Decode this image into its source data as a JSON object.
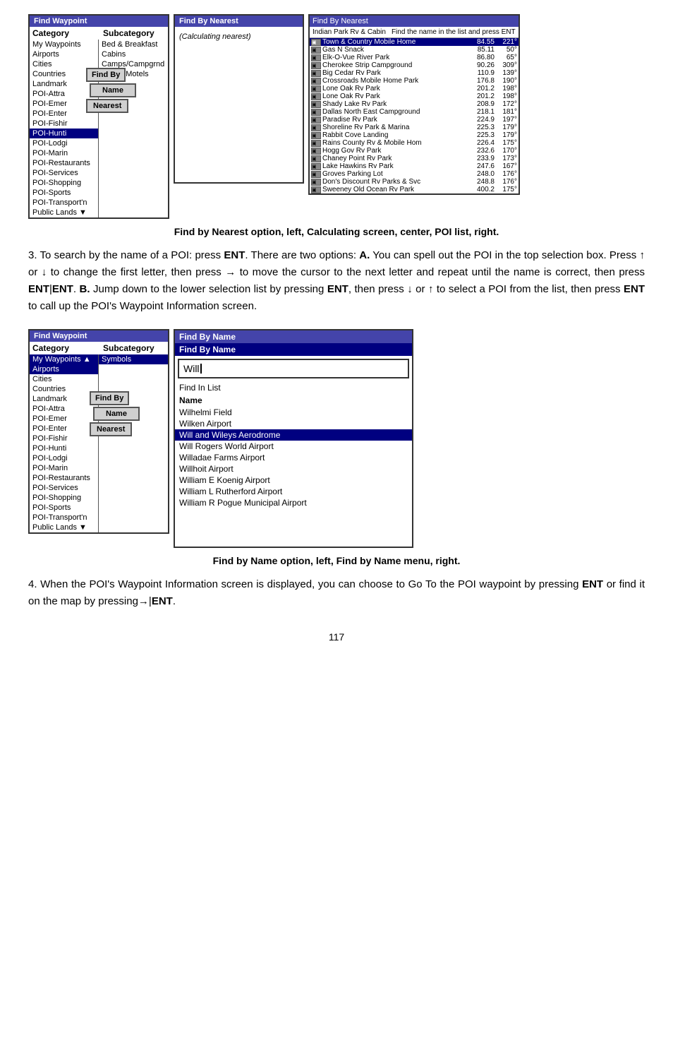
{
  "top_section": {
    "find_waypoint_panel": {
      "title": "Find Waypoint",
      "col1_header": "Category",
      "col2_header": "Subcategory",
      "categories": [
        {
          "label": "My Waypoints",
          "selected": false
        },
        {
          "label": "Airports",
          "selected": false
        },
        {
          "label": "Cities",
          "selected": false
        },
        {
          "label": "Countries",
          "selected": false
        },
        {
          "label": "Landmark",
          "selected": false
        },
        {
          "label": "POI-Attra",
          "selected": false
        },
        {
          "label": "POI-Emer",
          "selected": false
        },
        {
          "label": "POI-Enter",
          "selected": false
        },
        {
          "label": "POI-Fishir",
          "selected": false
        },
        {
          "label": "POI-Hunti",
          "selected": true
        },
        {
          "label": "POI-Lodgi",
          "selected": false
        },
        {
          "label": "POI-Marin",
          "selected": false
        },
        {
          "label": "POI-Restaurants",
          "selected": false
        },
        {
          "label": "POI-Services",
          "selected": false
        },
        {
          "label": "POI-Shopping",
          "selected": false
        },
        {
          "label": "POI-Sports",
          "selected": false
        },
        {
          "label": "POI-Transport'n",
          "selected": false
        },
        {
          "label": "Public Lands",
          "selected": false
        }
      ],
      "subcategories": [
        {
          "label": "Bed & Breakfast"
        },
        {
          "label": "Cabins"
        },
        {
          "label": "Camps/Campgrnd"
        },
        {
          "label": "Hotels/Motels"
        }
      ],
      "find_by_label": "Find By",
      "name_label": "Name",
      "nearest_label": "Nearest"
    },
    "find_by_nearest_panel": {
      "title": "Find By Nearest",
      "content": "(Calculating nearest)"
    },
    "find_by_nearest_results": {
      "title": "Find By Nearest",
      "prompt": "Find the name in the list",
      "prompt2": "and press ENT",
      "search_label": "Indian Park Rv & Cabin",
      "results": [
        {
          "icon": "rv",
          "name": "Town & Country Mobile Home",
          "dist": "84.55",
          "bearing": "221°",
          "selected": true
        },
        {
          "icon": "rv",
          "name": "Gas N Snack",
          "dist": "85.11",
          "bearing": "50°"
        },
        {
          "icon": "rv",
          "name": "Elk-O-Vue River Park",
          "dist": "86.80",
          "bearing": "65°"
        },
        {
          "icon": "rv",
          "name": "Cherokee Strip Campground",
          "dist": "90.26",
          "bearing": "309°"
        },
        {
          "icon": "rv",
          "name": "Big Cedar Rv Park",
          "dist": "110.9",
          "bearing": "139°"
        },
        {
          "icon": "rv",
          "name": "Crossroads Mobile Home Park",
          "dist": "176.8",
          "bearing": "190°"
        },
        {
          "icon": "rv",
          "name": "Lone Oak Rv Park",
          "dist": "201.2",
          "bearing": "198°"
        },
        {
          "icon": "rv",
          "name": "Lone Oak Rv Park",
          "dist": "201.2",
          "bearing": "198°"
        },
        {
          "icon": "rv",
          "name": "Shady Lake Rv Park",
          "dist": "208.9",
          "bearing": "172°"
        },
        {
          "icon": "rv",
          "name": "Dallas North East Campground",
          "dist": "218.1",
          "bearing": "181°"
        },
        {
          "icon": "rv",
          "name": "Paradise Rv Park",
          "dist": "224.9",
          "bearing": "197°"
        },
        {
          "icon": "rv",
          "name": "Shoreline Rv Park & Marina",
          "dist": "225.3",
          "bearing": "179°"
        },
        {
          "icon": "rv",
          "name": "Rabbit Cove Landing",
          "dist": "225.3",
          "bearing": "179°"
        },
        {
          "icon": "rv",
          "name": "Rains County Rv & Mobile Hom",
          "dist": "226.4",
          "bearing": "175°"
        },
        {
          "icon": "rv",
          "name": "Hogg Gov Rv Park",
          "dist": "232.6",
          "bearing": "170°"
        },
        {
          "icon": "rv",
          "name": "Chaney Point Rv Park",
          "dist": "233.9",
          "bearing": "173°"
        },
        {
          "icon": "rv",
          "name": "Lake Hawkins Rv Park",
          "dist": "247.6",
          "bearing": "167°"
        },
        {
          "icon": "rv",
          "name": "Groves Parking Lot",
          "dist": "248.0",
          "bearing": "176°"
        },
        {
          "icon": "rv",
          "name": "Don's Discount Rv Parks & Svc",
          "dist": "248.8",
          "bearing": "176°"
        },
        {
          "icon": "rv",
          "name": "Sweeney Old Ocean Rv Park",
          "dist": "400.2",
          "bearing": "175°"
        }
      ]
    }
  },
  "top_caption": "Find by Nearest option, left, Calculating screen, center, POI list, right.",
  "para1": {
    "text_before_a": "3. To search by the name of a POI: press ",
    "ent1": "ENT",
    "text_after_ent1": ". There are two options: ",
    "bold_a": "A.",
    "text_a": " You can spell out the POI in the top selection box. Press ",
    "arrow_up": "↑",
    "text_or": " or ",
    "arrow_down": "↓",
    "text_to": " to change the first letter, then press ",
    "arrow_right": "→",
    "text_move": " to move the cursor to the next letter and repeat until the name is correct, then press ",
    "ent2": "ENT",
    "pipe": "|",
    "ent3": "ENT",
    "text_b": ". ",
    "bold_b": "B.",
    "text_b2": " Jump down to the lower selection list by pressing ",
    "ent4": "ENT",
    "text_then": ", then press ",
    "arrow_down2": "↓",
    "text_or2": " or ",
    "arrow_up2": "↑",
    "text_select": " to select a POI from the list, then press ",
    "ent5": "ENT",
    "text_call": " to call up the POI's Waypoint Information screen."
  },
  "bottom_section": {
    "find_waypoint_panel2": {
      "title": "Find Waypoint",
      "col1_header": "Category",
      "col2_header": "Subcategory",
      "categories": [
        {
          "label": "My Waypoints",
          "selected": false
        },
        {
          "label": "Airports",
          "selected": true
        },
        {
          "label": "Cities",
          "selected": false
        },
        {
          "label": "Countries",
          "selected": false
        },
        {
          "label": "Landmark",
          "selected": false
        },
        {
          "label": "POI-Attra",
          "selected": false
        },
        {
          "label": "POI-Emer",
          "selected": false
        },
        {
          "label": "POI-Enter",
          "selected": false
        },
        {
          "label": "POI-Fishir",
          "selected": false
        },
        {
          "label": "POI-Hunti",
          "selected": false
        },
        {
          "label": "POI-Lodgi",
          "selected": false
        },
        {
          "label": "POI-Marin",
          "selected": false
        },
        {
          "label": "POI-Restaurants",
          "selected": false
        },
        {
          "label": "POI-Services",
          "selected": false
        },
        {
          "label": "POI-Shopping",
          "selected": false
        },
        {
          "label": "POI-Sports",
          "selected": false
        },
        {
          "label": "POI-Transport'n",
          "selected": false
        },
        {
          "label": "Public Lands",
          "selected": false
        }
      ],
      "subcategories": [
        {
          "label": "Symbols"
        }
      ],
      "find_by_label": "Find By",
      "name_label": "Name",
      "nearest_label": "Nearest"
    },
    "find_by_name_panel": {
      "title": "Find By Name",
      "subtitle": "Find By Name",
      "search_value": "Will",
      "find_in_list": "Find In List",
      "name_col": "Name",
      "items": [
        {
          "label": "Wilhelmi Field",
          "selected": false
        },
        {
          "label": "Wilken Airport",
          "selected": false
        },
        {
          "label": "Will and Wileys Aerodrome",
          "selected": true
        },
        {
          "label": "Will Rogers World Airport",
          "selected": false
        },
        {
          "label": "Willadae Farms Airport",
          "selected": false
        },
        {
          "label": "Willhoit Airport",
          "selected": false
        },
        {
          "label": "William E Koenig Airport",
          "selected": false
        },
        {
          "label": "William L Rutherford Airport",
          "selected": false
        },
        {
          "label": "William R Pogue Municipal Airport",
          "selected": false
        }
      ]
    }
  },
  "bottom_caption": "Find by Name option, left, Find by Name menu, right.",
  "para2": {
    "text": "4. When the POI's Waypoint Information screen is displayed, you can choose to Go To the POI waypoint by pressing ",
    "ent": "ENT",
    "text2": " or find it on the map by pressing",
    "arrow": "→",
    "pipe": "|",
    "ent2": "ENT",
    "text3": "."
  },
  "page_number": "117"
}
